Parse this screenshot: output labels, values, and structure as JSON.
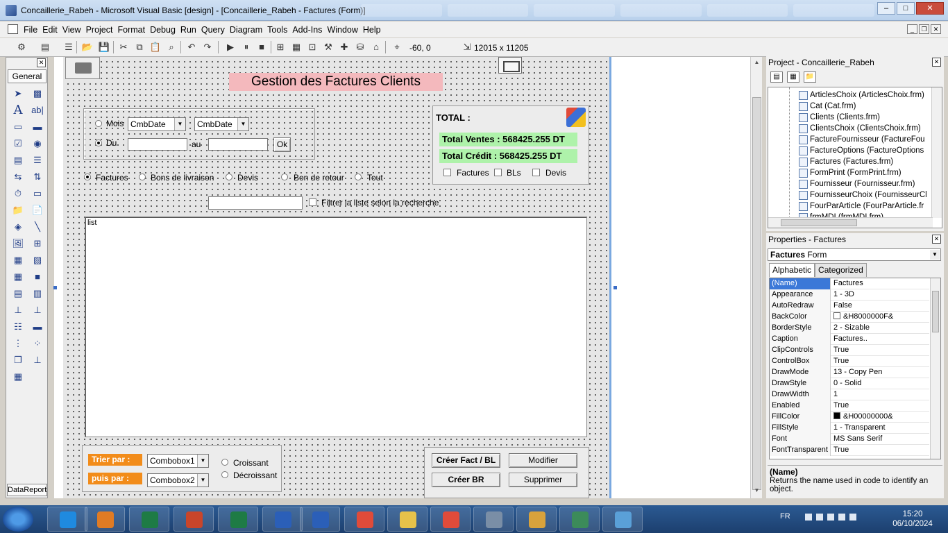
{
  "window": {
    "title": "Concaillerie_Rabeh - Microsoft Visual Basic [design] - [Concaillerie_Rabeh - Factures (Form)]",
    "minimize": "–",
    "maximize": "□",
    "close": "✕"
  },
  "menu": [
    "File",
    "Edit",
    "View",
    "Project",
    "Format",
    "Debug",
    "Run",
    "Query",
    "Diagram",
    "Tools",
    "Add-Ins",
    "Window",
    "Help"
  ],
  "toolbar": {
    "position": "-60, 0",
    "size": "12015 x 11205"
  },
  "toolbox": {
    "tab": "General",
    "bottom_tab": "DataReport",
    "close": "✕"
  },
  "form": {
    "title": "Gestion des Factures Clients",
    "date_filter": {
      "mois_label": "Mois",
      "combo1": "CmbDate",
      "combo2": "CmbDate",
      "du_label": "Du",
      "au_label": "au",
      "ok_button": "Ok"
    },
    "total": {
      "title": "TOTAL :",
      "ventes": "Total Ventes :  568425.255 DT",
      "credit": "Total Crédit  :  568425.255 DT",
      "checks": [
        "Factures",
        "BLs",
        "Devis"
      ]
    },
    "doc_types": [
      "Factures",
      "Bons de livraison",
      "Devis",
      "Bon de retour",
      "Tout"
    ],
    "filter_label": "Filtrer la liste selon la recherche",
    "list_label": "list",
    "sort": {
      "trier_label": "Trier par :",
      "puis_label": "puis par :",
      "combo1": "Combobox1",
      "combo2": "Combobox2",
      "croissant": "Croissant",
      "decroissant": "Décroissant"
    },
    "actions": {
      "create_fact": "Créer Fact / BL",
      "modify": "Modifier",
      "create_br": "Créer BR",
      "delete": "Supprimer"
    }
  },
  "project": {
    "title": "Project - Concaillerie_Rabeh",
    "items": [
      "ArticlesChoix (ArticlesChoix.frm)",
      "Cat (Cat.frm)",
      "Clients (Clients.frm)",
      "ClientsChoix (ClientsChoix.frm)",
      "FactureFournisseur (FactureFou",
      "FactureOptions (FactureOptions",
      "Factures (Factures.frm)",
      "FormPrint (FormPrint.frm)",
      "Fournisseur (Fournisseur.frm)",
      "FournisseurChoix (FournisseurCl",
      "FourParArticle (FourParArticle.fr",
      "frmMDI (frmMDI.frm)"
    ]
  },
  "properties": {
    "title": "Properties - Factures",
    "object_name": "Factures",
    "object_type": "Form",
    "tabs": [
      "Alphabetic",
      "Categorized"
    ],
    "rows": [
      {
        "name": "(Name)",
        "value": "Factures",
        "swatch": ""
      },
      {
        "name": "Appearance",
        "value": "1 - 3D",
        "swatch": ""
      },
      {
        "name": "AutoRedraw",
        "value": "False",
        "swatch": ""
      },
      {
        "name": "BackColor",
        "value": "&H8000000F&",
        "swatch": "#ffffff"
      },
      {
        "name": "BorderStyle",
        "value": "2 - Sizable",
        "swatch": ""
      },
      {
        "name": "Caption",
        "value": "Factures..",
        "swatch": ""
      },
      {
        "name": "ClipControls",
        "value": "True",
        "swatch": ""
      },
      {
        "name": "ControlBox",
        "value": "True",
        "swatch": ""
      },
      {
        "name": "DrawMode",
        "value": "13 - Copy Pen",
        "swatch": ""
      },
      {
        "name": "DrawStyle",
        "value": "0 - Solid",
        "swatch": ""
      },
      {
        "name": "DrawWidth",
        "value": "1",
        "swatch": ""
      },
      {
        "name": "Enabled",
        "value": "True",
        "swatch": ""
      },
      {
        "name": "FillColor",
        "value": "&H00000000&",
        "swatch": "#000000"
      },
      {
        "name": "FillStyle",
        "value": "1 - Transparent",
        "swatch": ""
      },
      {
        "name": "Font",
        "value": "MS Sans Serif",
        "swatch": ""
      },
      {
        "name": "FontTransparent",
        "value": "True",
        "swatch": ""
      }
    ],
    "desc_title": "(Name)",
    "desc_text": "Returns the name used in code to identify an object."
  },
  "taskbar": {
    "lang": "FR",
    "time": "15:20",
    "date": "06/10/2024",
    "apps": [
      "internet-explorer",
      "media-player",
      "excel",
      "powerpoint",
      "publisher",
      "visio",
      "word",
      "chrome",
      "file-explorer",
      "chrome-profile",
      "remote-desktop",
      "paint",
      "vb6",
      "image-viewer"
    ]
  },
  "colors": {
    "title_banner": "#f4b9bd",
    "totals_bg": "#aef2aa",
    "sort_labels": "#f28c1a",
    "selected_property": "#3b78d8"
  }
}
